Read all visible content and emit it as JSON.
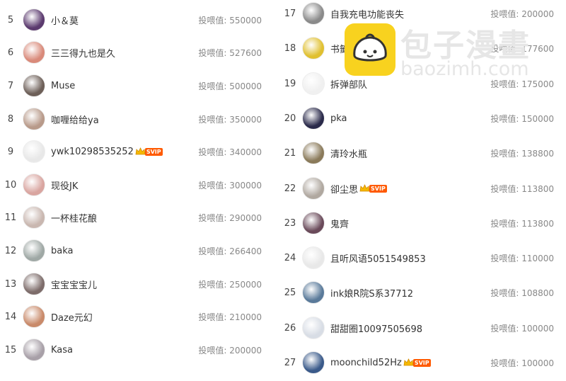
{
  "value_label": "投喂值:",
  "watermark": {
    "cn": "包子漫畫",
    "en": "baozimh.com",
    "icon": "bun-logo-icon"
  },
  "svip_label": "SVIP",
  "left": [
    {
      "rank": "5",
      "name": "小＆莫",
      "value": "550000",
      "svip": false,
      "color": "#5b3a6e"
    },
    {
      "rank": "6",
      "name": "三三得九也是久",
      "value": "527600",
      "svip": false,
      "color": "#d98a7a"
    },
    {
      "rank": "7",
      "name": "Muse",
      "value": "500000",
      "svip": false,
      "color": "#6d5f58"
    },
    {
      "rank": "8",
      "name": "咖喱给给ya",
      "value": "350000",
      "svip": false,
      "color": "#b89a8a"
    },
    {
      "rank": "9",
      "name": "ywk10298535252",
      "value": "340000",
      "svip": true,
      "color": "#e8e8e8"
    },
    {
      "rank": "10",
      "name": "现役JK",
      "value": "300000",
      "svip": false,
      "color": "#d9a5a0"
    },
    {
      "rank": "11",
      "name": "一杯桂花酿",
      "value": "290000",
      "svip": false,
      "color": "#c9b7b0"
    },
    {
      "rank": "12",
      "name": "baka",
      "value": "266400",
      "svip": false,
      "color": "#9fa8a5"
    },
    {
      "rank": "13",
      "name": "宝宝宝宝儿",
      "value": "250000",
      "svip": false,
      "color": "#7d6c6a"
    },
    {
      "rank": "14",
      "name": "Daze元幻",
      "value": "210000",
      "svip": false,
      "color": "#c98a6a"
    },
    {
      "rank": "15",
      "name": "Kasa",
      "value": "200000",
      "svip": false,
      "color": "#a8a0a8"
    }
  ],
  "right": [
    {
      "rank": "17",
      "name": "自我充电功能丧失",
      "value": "200000",
      "svip": false,
      "color": "#8a8a8a"
    },
    {
      "rank": "18",
      "name": "书籤",
      "value": "177600",
      "svip": true,
      "color": "#e0c030"
    },
    {
      "rank": "19",
      "name": "拆弹部队",
      "value": "175000",
      "svip": false,
      "color": "#f0f0f0"
    },
    {
      "rank": "20",
      "name": "pka",
      "value": "150000",
      "svip": false,
      "color": "#2a2a4a"
    },
    {
      "rank": "21",
      "name": "清玲水瓶",
      "value": "138800",
      "svip": false,
      "color": "#8a7a5a"
    },
    {
      "rank": "22",
      "name": "卻尘思",
      "value": "113800",
      "svip": true,
      "color": "#b0a8a0"
    },
    {
      "rank": "23",
      "name": "鬼齊",
      "value": "113800",
      "svip": false,
      "color": "#6a4a5a"
    },
    {
      "rank": "24",
      "name": "且听风语5051549853",
      "value": "110000",
      "svip": false,
      "color": "#e8e8e8"
    },
    {
      "rank": "25",
      "name": "ink娘R院S系37712",
      "value": "108800",
      "svip": false,
      "color": "#5a7a9a"
    },
    {
      "rank": "26",
      "name": "甜甜圈10097505698",
      "value": "100000",
      "svip": false,
      "color": "#d8dde5"
    },
    {
      "rank": "27",
      "name": "moonchild52Hz",
      "value": "100000",
      "svip": true,
      "color": "#3a5a8a"
    }
  ]
}
